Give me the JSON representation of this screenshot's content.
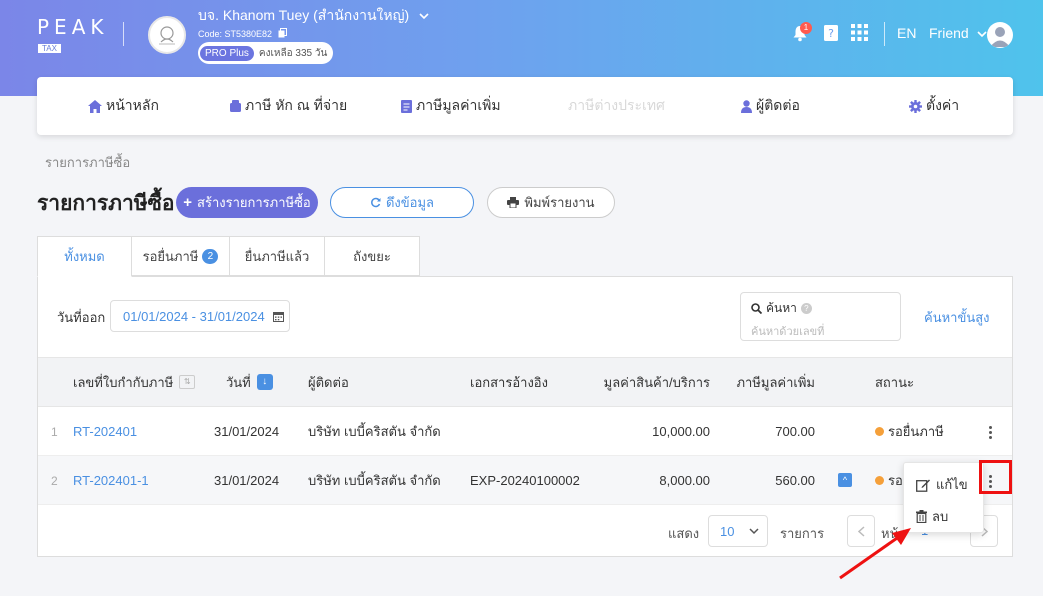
{
  "header": {
    "logo_text": "PEAK",
    "logo_sub": "TAX",
    "company_name": "บจ. Khanom Tuey (สำนักงานใหญ่)",
    "company_code": "Code: ST5380E82",
    "plan_badge": "PRO Plus",
    "plan_remaining": "คงเหลือ 335 วัน",
    "notification_count": "1",
    "language": "EN",
    "user_name": "Friend"
  },
  "nav": {
    "home": "หน้าหลัก",
    "withholding": "ภาษี หัก ณ ที่จ่าย",
    "vat": "ภาษีมูลค่าเพิ่ม",
    "foreign": "ภาษีต่างประเทศ",
    "contacts": "ผู้ติดต่อ",
    "settings": "ตั้งค่า"
  },
  "breadcrumb": "รายการภาษีซื้อ",
  "page_title": "รายการภาษีซื้อ",
  "buttons": {
    "create": "สร้างรายการภาษีซื้อ",
    "fetch": "ดึงข้อมูล",
    "print": "พิมพ์รายงาน"
  },
  "tabs": [
    {
      "label": "ทั้งหมด",
      "active": true
    },
    {
      "label": "รอยื่นภาษี",
      "count": "2"
    },
    {
      "label": "ยื่นภาษีแล้ว"
    },
    {
      "label": "ถังขยะ"
    }
  ],
  "filters": {
    "date_label": "วันที่ออก",
    "date_value": "01/01/2024 - 31/01/2024",
    "search_label": "ค้นหา",
    "search_placeholder": "ค้นหาด้วยเลขที่",
    "advanced_search": "ค้นหาขั้นสูง"
  },
  "table": {
    "columns": {
      "invoice_no": "เลขที่ใบกำกับภาษี",
      "date": "วันที่",
      "contact": "ผู้ติดต่อ",
      "reference": "เอกสารอ้างอิง",
      "amount": "มูลค่าสินค้า/บริการ",
      "vat": "ภาษีมูลค่าเพิ่ม",
      "status": "สถานะ"
    },
    "rows": [
      {
        "index": "1",
        "invoice_no": "RT-202401",
        "date": "31/01/2024",
        "contact": "บริษัท เบบี้คริสตัน จำกัด",
        "reference": "",
        "amount": "10,000.00",
        "vat": "700.00",
        "status": "รอยื่นภาษี"
      },
      {
        "index": "2",
        "invoice_no": "RT-202401-1",
        "date": "31/01/2024",
        "contact": "บริษัท เบบี้คริสตัน จำกัด",
        "reference": "EXP-20240100002",
        "amount": "8,000.00",
        "vat": "560.00",
        "status": "รอ"
      }
    ]
  },
  "pagination": {
    "show_label": "แสดง",
    "page_size": "10",
    "items_label": "รายการ",
    "page_label": "หน้า",
    "page_number": "1"
  },
  "row_menu": {
    "edit": "แก้ไข",
    "delete": "ลบ"
  },
  "colors": {
    "accent": "#4a90e2",
    "primary_button": "#6b6fdb",
    "status_pending": "#f5a03a",
    "highlight": "#e11111"
  }
}
